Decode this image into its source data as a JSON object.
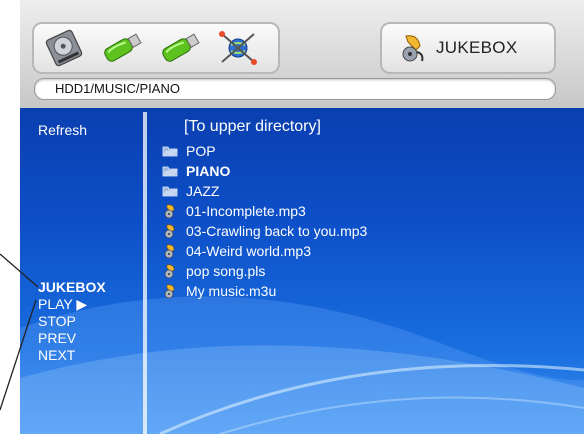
{
  "header": {
    "devices": [
      {
        "icon": "hard-disk-icon",
        "name": "hdd"
      },
      {
        "icon": "usb-drive-icon",
        "name": "usb1"
      },
      {
        "icon": "usb-drive-icon",
        "name": "usb2"
      },
      {
        "icon": "network-icon",
        "name": "network"
      }
    ],
    "mode_icon": "jukebox-icon",
    "mode_label": "JUKEBOX",
    "path": "HDD1/MUSIC/PIANO"
  },
  "sidebar": {
    "refresh": "Refresh",
    "menu": [
      "JUKEBOX",
      "PLAY ▶",
      "STOP",
      "PREV",
      "NEXT"
    ]
  },
  "list": {
    "upper": "[To upper directory]",
    "items": [
      {
        "label": "POP",
        "icon": "folder-icon",
        "bold": false
      },
      {
        "label": "PIANO",
        "icon": "folder-icon",
        "bold": true
      },
      {
        "label": "JAZZ",
        "icon": "folder-icon",
        "bold": false
      },
      {
        "label": "01-Incomplete.mp3",
        "icon": "music-file-icon",
        "bold": false
      },
      {
        "label": "03-Crawling back to you.mp3",
        "icon": "music-file-icon",
        "bold": false
      },
      {
        "label": "04-Weird world.mp3",
        "icon": "music-file-icon",
        "bold": false
      },
      {
        "label": "pop song.pls",
        "icon": "music-file-icon",
        "bold": false
      },
      {
        "label": "My music.m3u",
        "icon": "music-file-icon",
        "bold": false
      }
    ]
  },
  "colors": {
    "content_blue": "#0d4fc8",
    "text": "#ffffff"
  }
}
